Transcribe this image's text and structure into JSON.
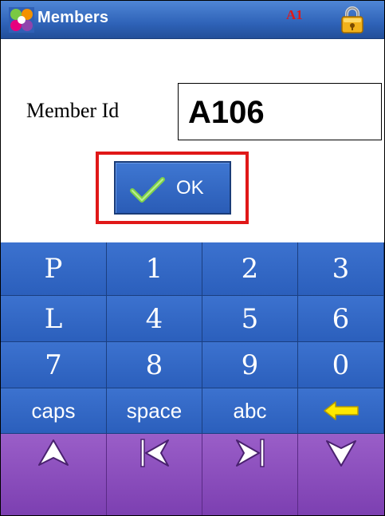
{
  "titlebar": {
    "title": "Members",
    "user_code": "A1"
  },
  "form": {
    "member_label": "Member Id",
    "member_value": "A106",
    "ok_label": "OK"
  },
  "keypad": {
    "row1": [
      "P",
      "1",
      "2",
      "3"
    ],
    "row2": [
      "L",
      "4",
      "5",
      "6"
    ],
    "row3": [
      "7",
      "8",
      "9",
      "0"
    ],
    "row4": [
      "caps",
      "space",
      "abc"
    ],
    "icons": {
      "backspace": "left-arrow-icon",
      "up": "up-arrow-icon",
      "first": "first-record-icon",
      "last": "last-record-icon",
      "down": "down-arrow-icon"
    }
  },
  "colors": {
    "title_bg": "#2f63b8",
    "key_blue": "#2b5fbc",
    "key_purple": "#7c3fb1",
    "highlight_red": "#e01818",
    "user_code_red": "#e01818"
  }
}
